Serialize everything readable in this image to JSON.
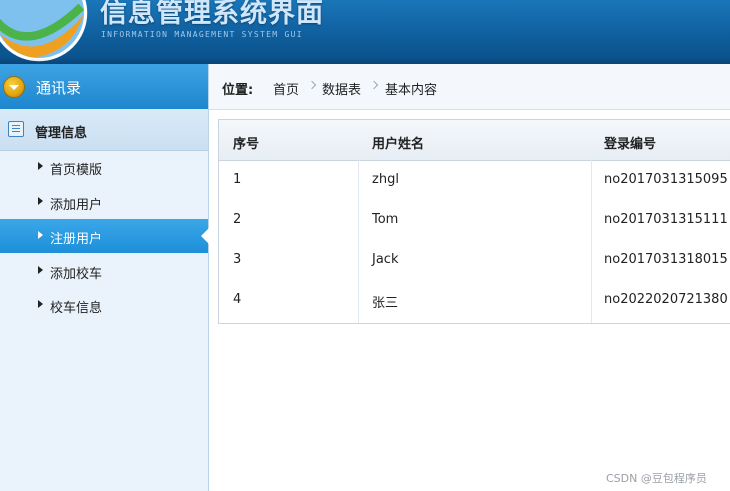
{
  "header": {
    "title": "信息管理系统界面",
    "subtitle": "INFORMATION MANAGEMENT SYSTEM GUI"
  },
  "sidebar": {
    "top_label": "通讯录",
    "section_label": "管理信息",
    "items": [
      {
        "label": "首页模版",
        "active": false
      },
      {
        "label": "添加用户",
        "active": false
      },
      {
        "label": "注册用户",
        "active": true
      },
      {
        "label": "添加校车",
        "active": false
      },
      {
        "label": "校车信息",
        "active": false
      }
    ]
  },
  "breadcrumb": {
    "lead": "位置:",
    "items": [
      "首页",
      "数据表",
      "基本内容"
    ]
  },
  "table": {
    "headers": [
      "序号",
      "用户姓名",
      "登录编号"
    ],
    "rows": [
      [
        "1",
        "zhgl",
        "no2017031315095"
      ],
      [
        "2",
        "Tom",
        "no2017031315111"
      ],
      [
        "3",
        "Jack",
        "no2017031318015"
      ],
      [
        "4",
        "张三",
        "no2022020721380"
      ]
    ]
  },
  "watermark": "CSDN @豆包程序员",
  "colors": {
    "header_bg": "#0f5f9e",
    "sidebar_bg": "#eaf3fb",
    "active_item": "#1e8fd8"
  }
}
